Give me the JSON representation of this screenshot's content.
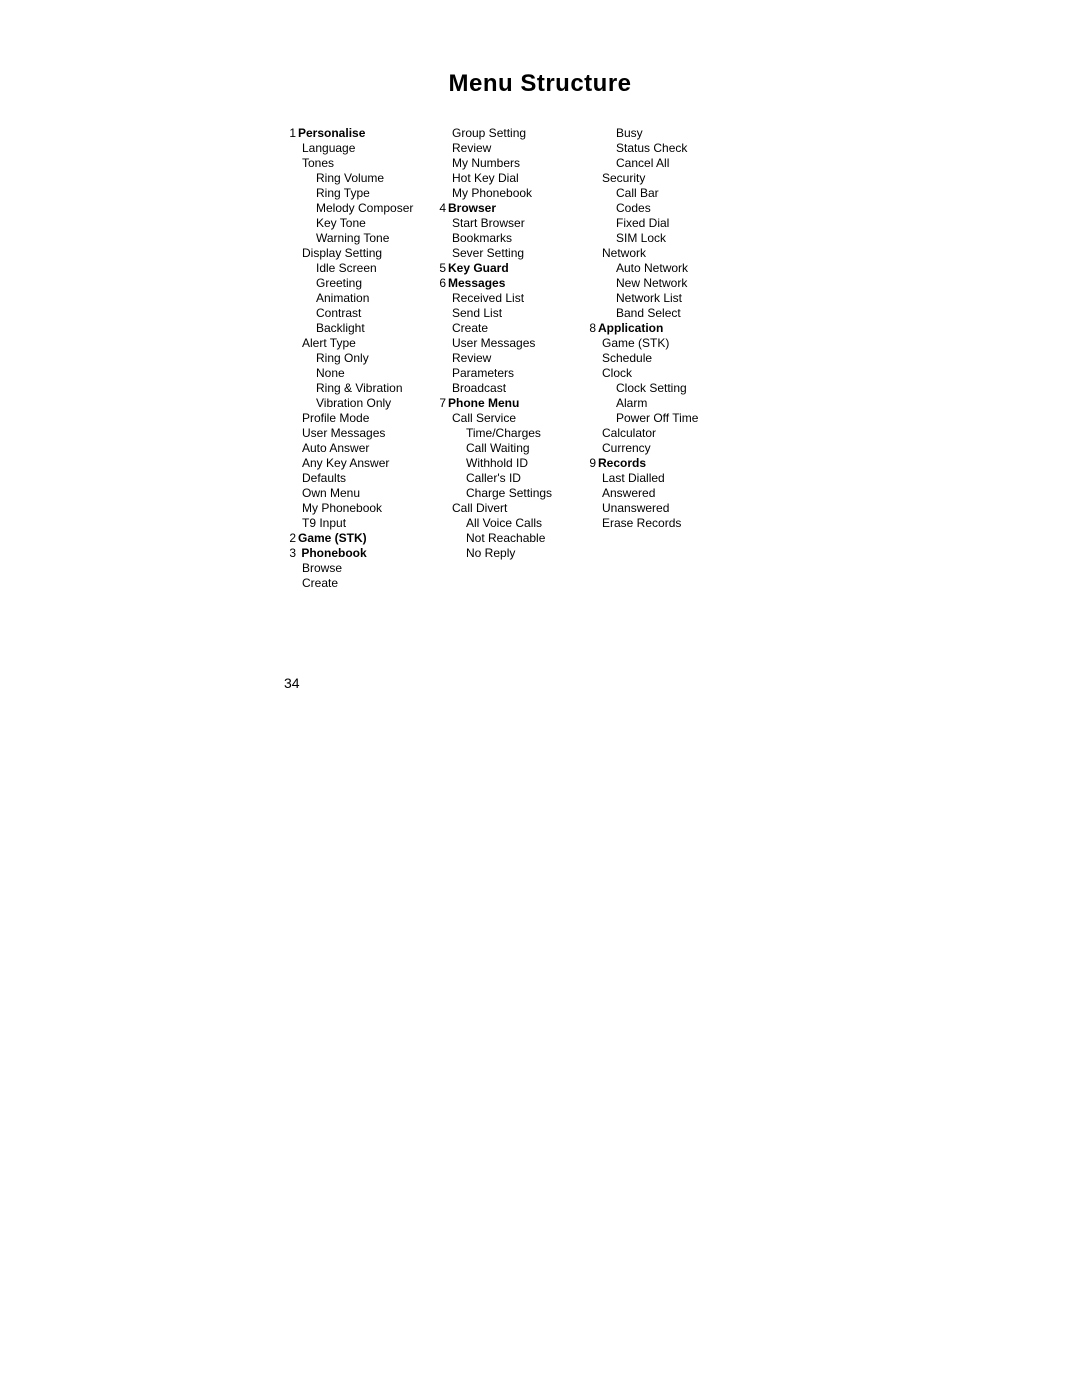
{
  "title": "Menu Structure",
  "pageNumber": "34",
  "columns": [
    [
      {
        "level": 0,
        "num": "1",
        "label": "Personalise",
        "head": true
      },
      {
        "level": 1,
        "label": "Language"
      },
      {
        "level": 1,
        "label": "Tones"
      },
      {
        "level": 2,
        "label": "Ring Volume"
      },
      {
        "level": 2,
        "label": "Ring Type"
      },
      {
        "level": 2,
        "label": "Melody Composer"
      },
      {
        "level": 2,
        "label": "Key Tone"
      },
      {
        "level": 2,
        "label": "Warning Tone"
      },
      {
        "level": 1,
        "label": "Display Setting"
      },
      {
        "level": 2,
        "label": "Idle Screen"
      },
      {
        "level": 2,
        "label": "Greeting"
      },
      {
        "level": 2,
        "label": "Animation"
      },
      {
        "level": 2,
        "label": "Contrast"
      },
      {
        "level": 2,
        "label": "Backlight"
      },
      {
        "level": 1,
        "label": "Alert Type"
      },
      {
        "level": 2,
        "label": "Ring Only"
      },
      {
        "level": 2,
        "label": "None"
      },
      {
        "level": 2,
        "label": "Ring & Vibration"
      },
      {
        "level": 2,
        "label": "Vibration Only"
      },
      {
        "level": 1,
        "label": "Profile Mode"
      },
      {
        "level": 1,
        "label": "User Messages"
      },
      {
        "level": 1,
        "label": "Auto Answer"
      },
      {
        "level": 1,
        "label": "Any Key Answer"
      },
      {
        "level": 1,
        "label": "Defaults"
      },
      {
        "level": 1,
        "label": "Own Menu"
      },
      {
        "level": 1,
        "label": "My Phonebook"
      },
      {
        "level": 1,
        "label": "T9 Input"
      },
      {
        "level": 0,
        "num": "2",
        "label": "Game (STK)",
        "head": true
      },
      {
        "level": 0,
        "num": "3",
        "label": "Phonebook",
        "head": true,
        "space": true
      },
      {
        "level": 1,
        "label": "Browse"
      },
      {
        "level": 1,
        "label": "Create"
      }
    ],
    [
      {
        "level": 1,
        "label": "Group Setting"
      },
      {
        "level": 1,
        "label": "Review"
      },
      {
        "level": 1,
        "label": "My Numbers"
      },
      {
        "level": 1,
        "label": "Hot Key Dial"
      },
      {
        "level": 1,
        "label": "My Phonebook"
      },
      {
        "level": 0,
        "num": "4",
        "label": "Browser",
        "head": true
      },
      {
        "level": 1,
        "label": "Start Browser"
      },
      {
        "level": 1,
        "label": "Bookmarks"
      },
      {
        "level": 1,
        "label": "Sever Setting"
      },
      {
        "level": 0,
        "num": "5",
        "label": "Key Guard",
        "head": true
      },
      {
        "level": 0,
        "num": "6",
        "label": "Messages",
        "head": true
      },
      {
        "level": 1,
        "label": "Received List"
      },
      {
        "level": 1,
        "label": "Send List"
      },
      {
        "level": 1,
        "label": "Create"
      },
      {
        "level": 1,
        "label": "User Messages"
      },
      {
        "level": 1,
        "label": "Review"
      },
      {
        "level": 1,
        "label": "Parameters"
      },
      {
        "level": 1,
        "label": "Broadcast"
      },
      {
        "level": 0,
        "num": "7",
        "label": "Phone Menu",
        "head": true
      },
      {
        "level": 1,
        "label": "Call Service"
      },
      {
        "level": 2,
        "label": "Time/Charges"
      },
      {
        "level": 2,
        "label": "Call Waiting"
      },
      {
        "level": 2,
        "label": "Withhold ID"
      },
      {
        "level": 2,
        "label": "Caller's ID"
      },
      {
        "level": 2,
        "label": "Charge Settings"
      },
      {
        "level": 1,
        "label": "Call Divert"
      },
      {
        "level": 2,
        "label": "All Voice Calls"
      },
      {
        "level": 2,
        "label": "Not Reachable"
      },
      {
        "level": 2,
        "label": "No Reply"
      }
    ],
    [
      {
        "level": 2,
        "label": "Busy"
      },
      {
        "level": 2,
        "label": "Status Check"
      },
      {
        "level": 2,
        "label": "Cancel All"
      },
      {
        "level": 1,
        "label": "Security"
      },
      {
        "level": 2,
        "label": "Call Bar"
      },
      {
        "level": 2,
        "label": "Codes"
      },
      {
        "level": 2,
        "label": "Fixed Dial"
      },
      {
        "level": 2,
        "label": "SIM Lock"
      },
      {
        "level": 1,
        "label": "Network"
      },
      {
        "level": 2,
        "label": "Auto Network"
      },
      {
        "level": 2,
        "label": "New Network"
      },
      {
        "level": 2,
        "label": "Network List"
      },
      {
        "level": 2,
        "label": "Band Select"
      },
      {
        "level": 0,
        "num": "8",
        "label": "Application",
        "head": true
      },
      {
        "level": 1,
        "label": "Game (STK)"
      },
      {
        "level": 1,
        "label": "Schedule"
      },
      {
        "level": 1,
        "label": "Clock"
      },
      {
        "level": 2,
        "label": "Clock Setting"
      },
      {
        "level": 2,
        "label": "Alarm"
      },
      {
        "level": 2,
        "label": "Power Off Time"
      },
      {
        "level": 1,
        "label": "Calculator"
      },
      {
        "level": 1,
        "label": "Currency"
      },
      {
        "level": 0,
        "num": "9",
        "label": "Records",
        "head": true
      },
      {
        "level": 1,
        "label": "Last Dialled"
      },
      {
        "level": 1,
        "label": "Answered"
      },
      {
        "level": 1,
        "label": "Unanswered"
      },
      {
        "level": 1,
        "label": "Erase Records"
      }
    ]
  ]
}
